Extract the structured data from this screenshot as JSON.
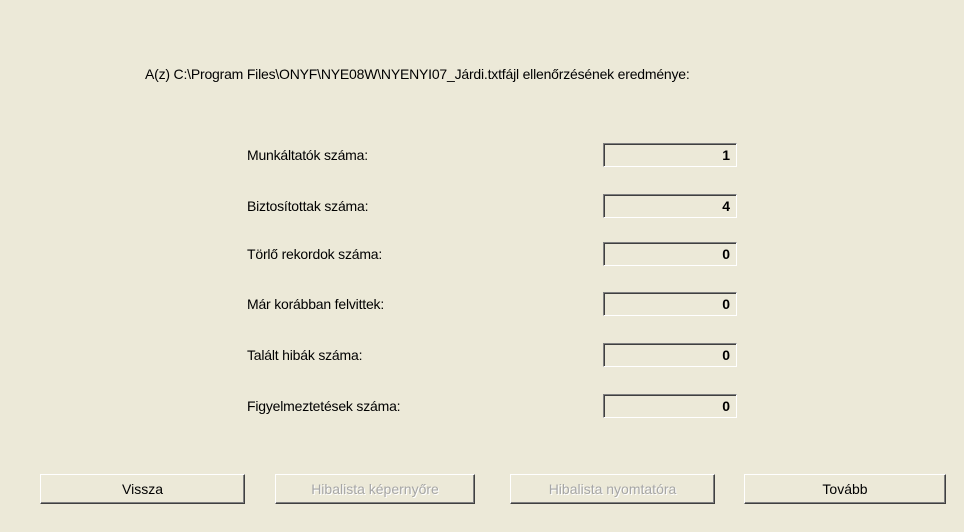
{
  "header": {
    "text": "A(z) C:\\Program Files\\ONYF\\NYE08W\\NYENYI07_Járdi.txtfájl ellenőrzésének eredménye:"
  },
  "stats": [
    {
      "label": "Munkáltatók száma:",
      "value": "1"
    },
    {
      "label": "Biztosítottak száma:",
      "value": "4"
    },
    {
      "label": "Törlő rekordok száma:",
      "value": "0"
    },
    {
      "label": "Már korábban felvittek:",
      "value": "0"
    },
    {
      "label": "Talált hibák száma:",
      "value": "0"
    },
    {
      "label": "Figyelmeztetések száma:",
      "value": "0"
    }
  ],
  "buttons": {
    "back": "Vissza",
    "error_list_screen": "Hibalista képernyőre",
    "error_list_print": "Hibalista nyomtatóra",
    "next": "Tovább"
  },
  "button_states": {
    "error_list_screen_enabled": false,
    "error_list_print_enabled": false
  }
}
